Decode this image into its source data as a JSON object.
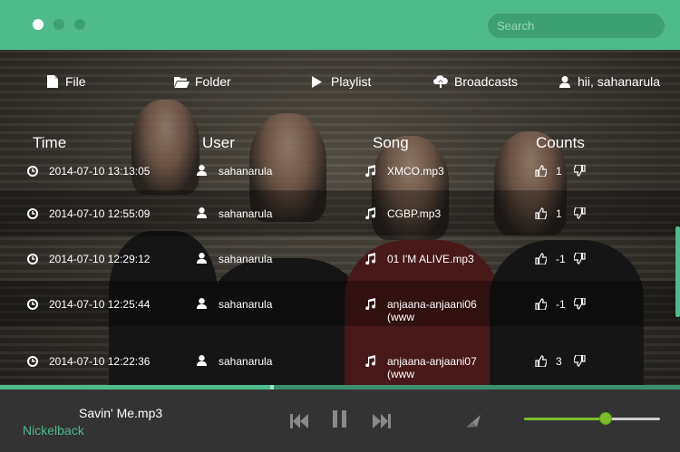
{
  "window": {
    "dot_colors": [
      "#ffffff",
      "#3d9f74",
      "#3d9f74"
    ]
  },
  "search": {
    "placeholder": "Search",
    "value": ""
  },
  "nav": {
    "file": "File",
    "folder": "Folder",
    "playlist": "Playlist",
    "broadcasts": "Broadcasts",
    "user": "hii, sahanarula"
  },
  "table": {
    "headers": {
      "time": "Time",
      "user": "User",
      "song": "Song",
      "counts": "Counts"
    },
    "rows": [
      {
        "time": "2014-07-10 13:13:05",
        "user": "sahanarula",
        "song": "XMCO.mp3",
        "count": "1"
      },
      {
        "time": "2014-07-10 12:55:09",
        "user": "sahanarula",
        "song": "CGBP.mp3",
        "count": "1"
      },
      {
        "time": "2014-07-10 12:29:12",
        "user": "sahanarula",
        "song": "01 I'M ALIVE.mp3",
        "count": "-1"
      },
      {
        "time": "2014-07-10 12:25:44",
        "user": "sahanarula",
        "song": "anjaana-anjaani06(www",
        "count": "-1"
      },
      {
        "time": "2014-07-10 12:22:36",
        "user": "sahanarula",
        "song": "anjaana-anjaani07(www",
        "count": "3"
      }
    ]
  },
  "player": {
    "track_title": "Savin' Me.mp3",
    "artist": "Nickelback",
    "progress": 0.4,
    "volume": 0.6
  },
  "colors": {
    "accent": "#4fba8c",
    "accent_dark": "#3d9f74",
    "volume": "#7cbd2a",
    "player_bg": "#333333"
  }
}
